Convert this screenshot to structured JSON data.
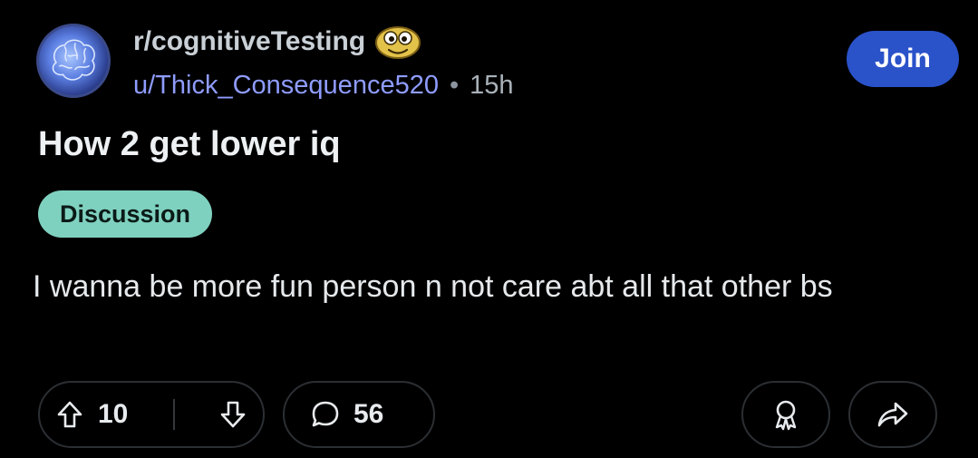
{
  "post": {
    "subreddit": "r/cognitiveTesting",
    "author": "u/Thick_Consequence520",
    "separator": "•",
    "age": "15h",
    "title": "How 2 get lower iq",
    "flair": "Discussion",
    "body": "I wanna be more fun person n not care abt all that other bs",
    "join_label": "Join"
  },
  "actions": {
    "upvotes": "10",
    "comments": "56"
  },
  "icons": {
    "avatar": "brain-avatar",
    "subreddit_emoji": "goofy-face-emoji",
    "upvote": "arrow-up-icon",
    "downvote": "arrow-down-icon",
    "comment": "comment-bubble-icon",
    "award": "award-icon",
    "share": "share-icon"
  },
  "colors": {
    "background": "#000000",
    "join_button": "#2a52c9",
    "flair_bg": "#7fd1bf",
    "username": "#8f9cff",
    "pill_border": "#2b2f33"
  }
}
